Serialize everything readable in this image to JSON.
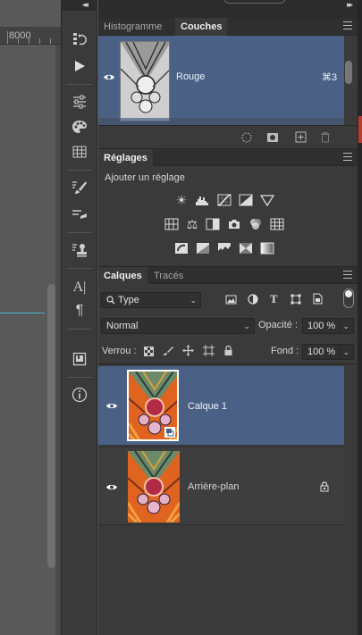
{
  "ruler": {
    "value": "8000"
  },
  "channels_panel": {
    "tabs": [
      "Histogramme",
      "Couches"
    ],
    "active_tab": "Couches",
    "channels": [
      {
        "name": "Rouge",
        "shortcut": "⌘3"
      }
    ]
  },
  "adjustments_panel": {
    "tab": "Réglages",
    "hint": "Ajouter un réglage"
  },
  "layers_panel": {
    "tabs": [
      "Calques",
      "Tracés"
    ],
    "active_tab": "Calques",
    "filter": "Type",
    "blend_mode": "Normal",
    "opacity_label": "Opacité :",
    "opacity_value": "100 %",
    "lock_label": "Verrou :",
    "fill_label": "Fond :",
    "fill_value": "100 %",
    "layers": [
      {
        "name": "Calque 1",
        "selected": true
      },
      {
        "name": "Arrière-plan",
        "selected": false,
        "locked": true
      }
    ]
  },
  "colors": {
    "selection": "#4a6185",
    "panel": "#3a3a3a",
    "guide": "#3fb6c6"
  }
}
